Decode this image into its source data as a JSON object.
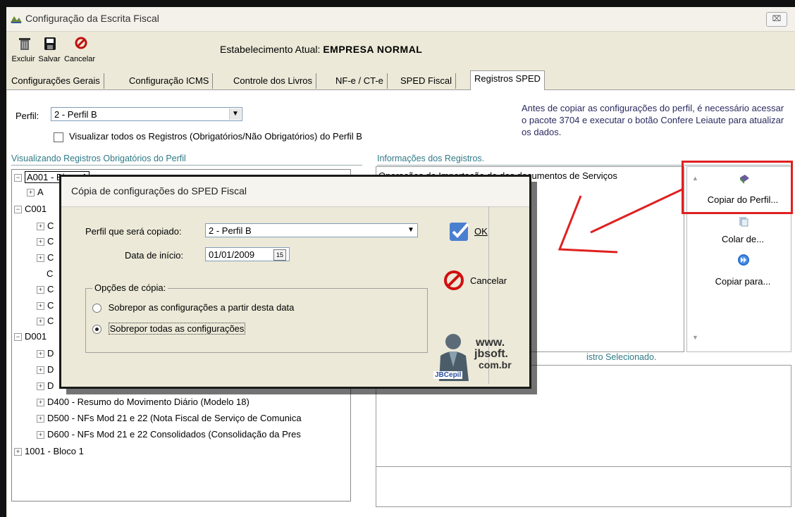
{
  "window": {
    "title": "Configuração da Escrita Fiscal",
    "close_glyph": "⌧"
  },
  "toolbar": {
    "delete_label": "Excluir",
    "save_label": "Salvar",
    "cancel_label": "Cancelar"
  },
  "establishment": {
    "label": "Estabelecimento Atual:",
    "value": "EMPRESA NORMAL"
  },
  "tabs": [
    {
      "label": "Configurações Gerais"
    },
    {
      "label": "Configuração ICMS"
    },
    {
      "label": "Controle dos Livros"
    },
    {
      "label": "NF-e / CT-e"
    },
    {
      "label": "SPED Fiscal"
    },
    {
      "label": "Registros SPED"
    }
  ],
  "perfil": {
    "label": "Perfil:",
    "value": "2 - Perfil B",
    "checkbox_label": "Visualizar todos os Registros (Obrigatórios/Não Obrigatórios) do Perfil B"
  },
  "note": "Antes de copiar as configurações do perfil, é necessário acessar o pacote 3704 e executar o botão Confere Leiaute para atualizar os dados.",
  "tree_panel": {
    "title": "Visualizando Registros Obrigatórios do Perfil",
    "items_before": [
      {
        "label": "A001 - Bloco A"
      },
      {
        "label": "A"
      },
      {
        "label": "C001"
      },
      {
        "label": "C"
      },
      {
        "label": "C"
      },
      {
        "label": "C"
      },
      {
        "label": "C"
      },
      {
        "label": "C"
      },
      {
        "label": "C"
      },
      {
        "label": "C"
      },
      {
        "label": "D001"
      },
      {
        "label": "D"
      },
      {
        "label": "D"
      },
      {
        "label": "D"
      }
    ],
    "items_after": [
      {
        "label": "D400 - Resumo do Movimento Diário (Modelo 18)"
      },
      {
        "label": "D500 - NFs Mod 21 e 22 (Nota Fiscal de Serviço de Comunica"
      },
      {
        "label": "D600 - NFs Mod 21 e 22 Consolidados (Consolidação da Pres"
      },
      {
        "label": "1001 - Bloco 1"
      }
    ]
  },
  "info_panel": {
    "title": "Informações dos Registros.",
    "first_row": "Operações de Importação de dos documentos de Serviços",
    "selected_title": "istro Selecionado."
  },
  "side_buttons": {
    "copy_from": "Copiar do Perfil...",
    "paste": "Colar de...",
    "copy_to": "Copiar para..."
  },
  "dialog": {
    "title": "Cópia de configurações do SPED Fiscal",
    "perfil_label": "Perfil que será copiado:",
    "perfil_value": "2 - Perfil B",
    "date_label": "Data de início:",
    "date_value": "01/01/2009",
    "date_icon_text": "15",
    "options_legend": "Opções de cópia:",
    "option1": "Sobrepor as configurações a partir desta data",
    "option2": "Sobrepor todas as configurações",
    "ok_label": "OK",
    "cancel_label": "Cancelar",
    "logo": {
      "line1": "www.",
      "line2": "jbsoft.",
      "line3": "com.br",
      "brand": "JBCepil"
    }
  },
  "colors": {
    "annotation_red": "#e02020",
    "group_title": "#2f7a86"
  }
}
